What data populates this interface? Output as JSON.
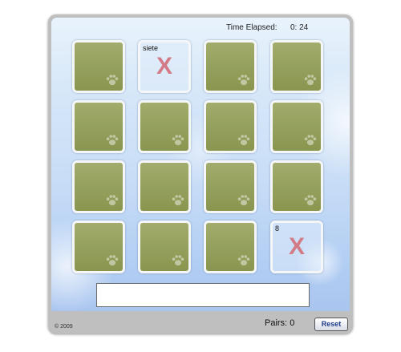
{
  "game": {
    "time_label": "Time Elapsed:",
    "time_value": "0: 24",
    "pairs_label": "Pairs:",
    "pairs_value": "0",
    "reset_label": "Reset",
    "copyright": "© 2009",
    "answer_value": ""
  },
  "cards": [
    {
      "state": "face-down"
    },
    {
      "state": "face-up",
      "word": "siete",
      "mark": "X"
    },
    {
      "state": "face-down"
    },
    {
      "state": "face-down"
    },
    {
      "state": "face-down"
    },
    {
      "state": "face-down"
    },
    {
      "state": "face-down"
    },
    {
      "state": "face-down"
    },
    {
      "state": "face-down"
    },
    {
      "state": "face-down"
    },
    {
      "state": "face-down"
    },
    {
      "state": "face-down"
    },
    {
      "state": "face-down"
    },
    {
      "state": "face-down"
    },
    {
      "state": "face-down"
    },
    {
      "state": "face-up",
      "word": "8",
      "mark": "X"
    }
  ],
  "colors": {
    "card_back": "#939f5c",
    "mismatch_mark": "#d27a86",
    "reset_text": "#1f3c8a"
  },
  "icons": {
    "card_back": "paw-print-icon"
  }
}
